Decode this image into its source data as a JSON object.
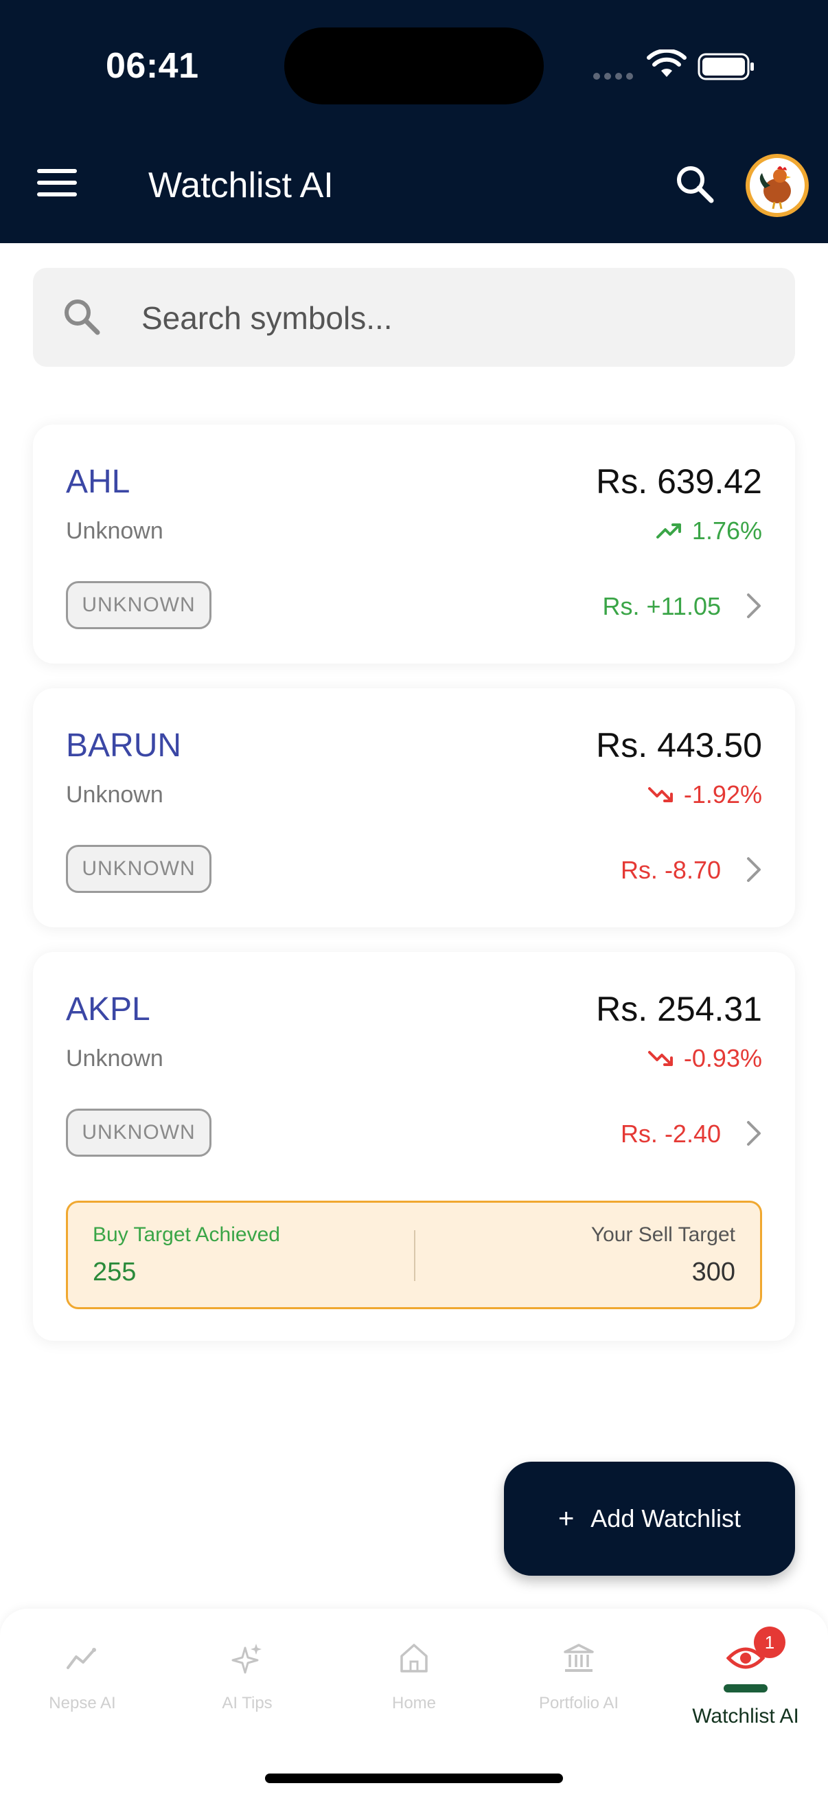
{
  "status": {
    "time": "06:41"
  },
  "header": {
    "title": "Watchlist AI"
  },
  "search": {
    "placeholder": "Search symbols..."
  },
  "stocks": [
    {
      "symbol": "AHL",
      "sector": "Unknown",
      "price": "Rs. 639.42",
      "percent": "1.76%",
      "change": "Rs. +11.05",
      "badge": "UNKNOWN",
      "direction": "up"
    },
    {
      "symbol": "BARUN",
      "sector": "Unknown",
      "price": "Rs. 443.50",
      "percent": "-1.92%",
      "change": "Rs. -8.70",
      "badge": "UNKNOWN",
      "direction": "down"
    },
    {
      "symbol": "AKPL",
      "sector": "Unknown",
      "price": "Rs. 254.31",
      "percent": "-0.93%",
      "change": "Rs. -2.40",
      "badge": "UNKNOWN",
      "direction": "down"
    }
  ],
  "target": {
    "buy_label": "Buy Target Achieved",
    "buy_value": "255",
    "sell_label": "Your Sell Target",
    "sell_value": "300"
  },
  "fab": {
    "label": "Add Watchlist"
  },
  "nav": {
    "items": [
      {
        "label": "Nepse AI",
        "icon": "trend-icon"
      },
      {
        "label": "AI Tips",
        "icon": "sparkle-icon"
      },
      {
        "label": "Home",
        "icon": "home-icon"
      },
      {
        "label": "Portfolio AI",
        "icon": "bank-icon"
      },
      {
        "label": "Watchlist AI",
        "icon": "eye-icon"
      }
    ],
    "badge": "1"
  },
  "colors": {
    "header_bg": "#04162f",
    "positive": "#3aa547",
    "negative": "#e53935",
    "symbol": "#3b47a5",
    "target_border": "#f0a830"
  }
}
